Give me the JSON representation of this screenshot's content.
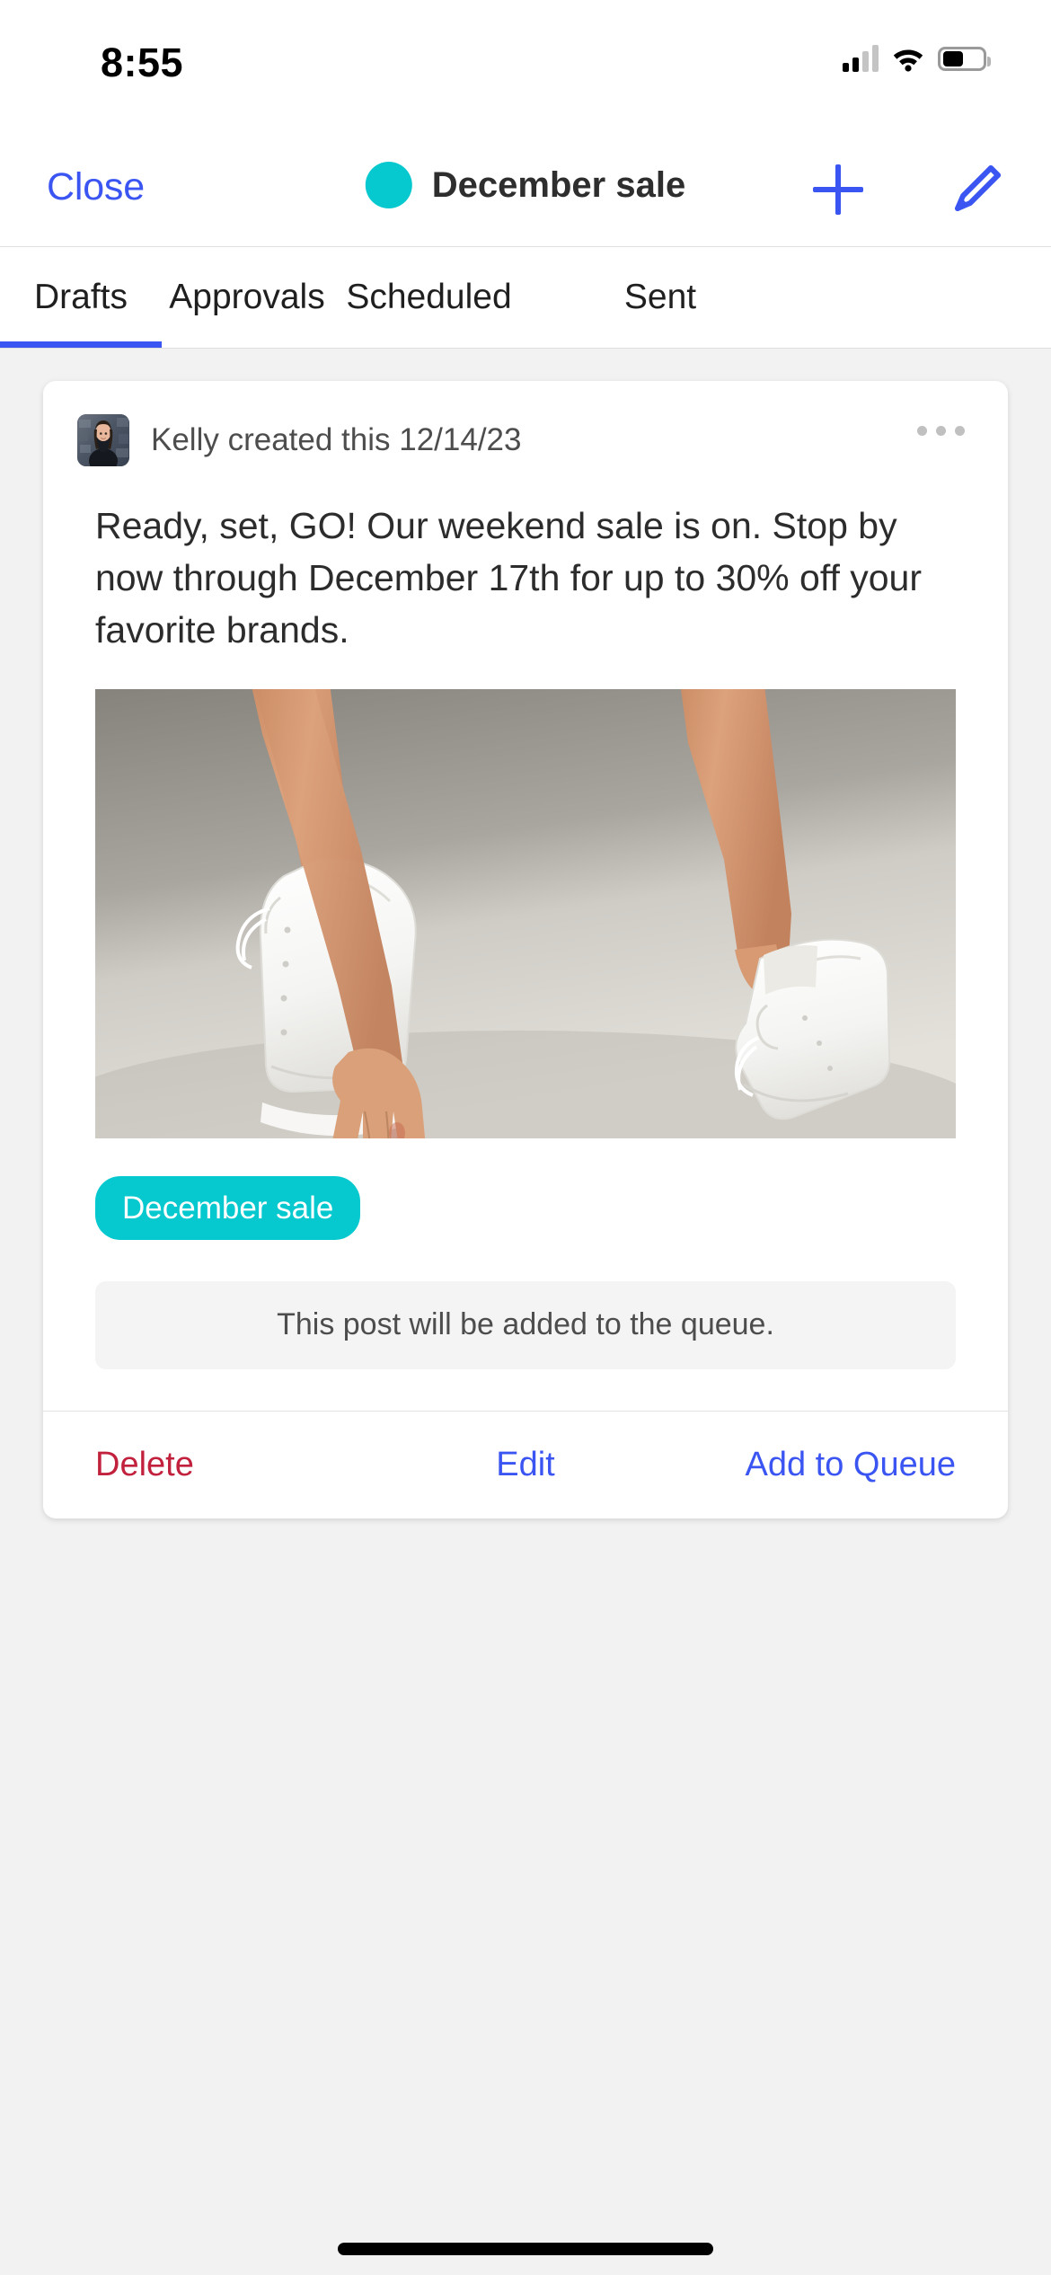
{
  "status_bar": {
    "time": "8:55",
    "signal_icon": "cellular-signal-icon",
    "wifi_icon": "wifi-icon",
    "battery_icon": "battery-icon",
    "battery_level_percent": 50
  },
  "navbar": {
    "close_label": "Close",
    "title": "December sale",
    "dot_color": "#06c9cf",
    "add_icon": "plus-icon",
    "compose_icon": "pencil-icon",
    "accent_color": "#3b55f2"
  },
  "tabs": {
    "items": [
      {
        "label": "Drafts",
        "active": true
      },
      {
        "label": "Approvals",
        "active": false
      },
      {
        "label": "Scheduled",
        "active": false
      },
      {
        "label": "Sent",
        "active": false
      }
    ],
    "active_underline_color": "#3b55f2"
  },
  "post_card": {
    "author": "Kelly",
    "byline": "Kelly created this 12/14/23",
    "avatar_alt": "Kelly profile photo",
    "overflow_icon": "more-options-icon",
    "body": "Ready, set, GO! Our weekend sale is on. Stop by now through December 17th for up to 30% off your favorite brands.",
    "media_alt": "Legs wearing white leather sneakers with a hand reaching down",
    "tag": "December sale",
    "tag_color": "#06c9cf",
    "queue_notice": "This post will be added to the queue.",
    "actions": {
      "delete": "Delete",
      "edit": "Edit",
      "queue": "Add to Queue"
    },
    "action_colors": {
      "delete": "#c2213d",
      "edit": "#3b55f2",
      "queue": "#3b55f2"
    }
  },
  "home_indicator": "home-indicator-bar"
}
